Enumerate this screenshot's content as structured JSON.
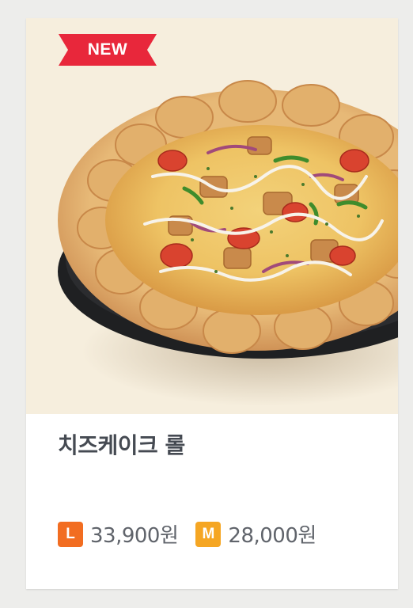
{
  "product": {
    "badge": "NEW",
    "name": "치즈케이크 롤",
    "prices": [
      {
        "size_label": "L",
        "price": "33,900원"
      },
      {
        "size_label": "M",
        "price": "28,000원"
      }
    ]
  },
  "colors": {
    "badge_bg": "#e8273b",
    "size_l_bg": "#f26d21",
    "size_m_bg": "#f5a623",
    "image_bg": "#f6eedd",
    "title_text": "#454a52",
    "price_text": "#60646b"
  },
  "icons": [
    "size-l-icon",
    "size-m-icon",
    "pizza-image",
    "new-ribbon"
  ]
}
